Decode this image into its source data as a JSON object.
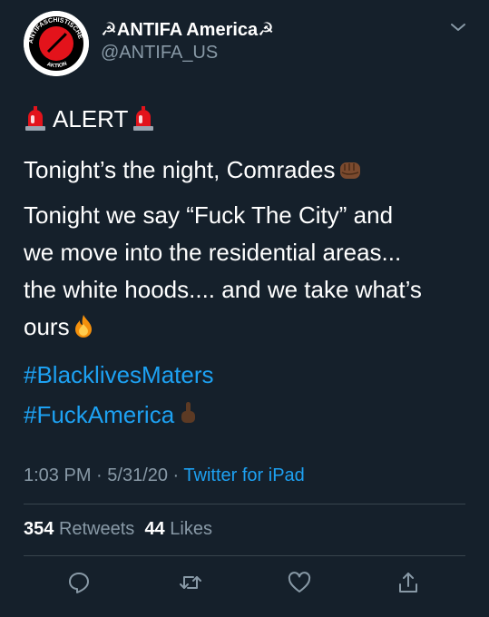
{
  "tweet": {
    "display_name": "☭ANTIFA America☭",
    "handle": "@ANTIFA_US",
    "avatar": {
      "top_text": "ANTIFASCHISTISCHE",
      "bottom_text": "AKTION"
    },
    "alert_text": "ALERT",
    "line_comrades": "Tonight’s the night, Comrades",
    "paragraph_lines": [
      "Tonight we say “Fuck The City” and",
      "we move into the residential areas...",
      "the white hoods.... and we take what’s",
      "ours"
    ],
    "hashtags": [
      "#BlacklivesMaters",
      "#FuckAmerica"
    ],
    "time": "1:03 PM",
    "date": "5/31/20",
    "separator": " · ",
    "source": "Twitter for iPad",
    "retweets_count": "354",
    "retweets_label": "Retweets",
    "likes_count": "44",
    "likes_label": "Likes"
  },
  "icons": {
    "menu": "chevron-down-icon",
    "reply": "reply-icon",
    "retweet": "retweet-icon",
    "like": "heart-icon",
    "share": "share-icon",
    "emoji_alert": "police-siren-emoji",
    "emoji_comrades": "raised-fist-emoji",
    "emoji_ours": "fire-emoji",
    "emoji_hashtag": "middle-finger-emoji"
  },
  "colors": {
    "background": "#15202b",
    "text": "#ffffff",
    "secondary": "#8899a6",
    "link": "#1da1f2",
    "divider": "#38444d",
    "avatar_red": "#e3131b"
  }
}
